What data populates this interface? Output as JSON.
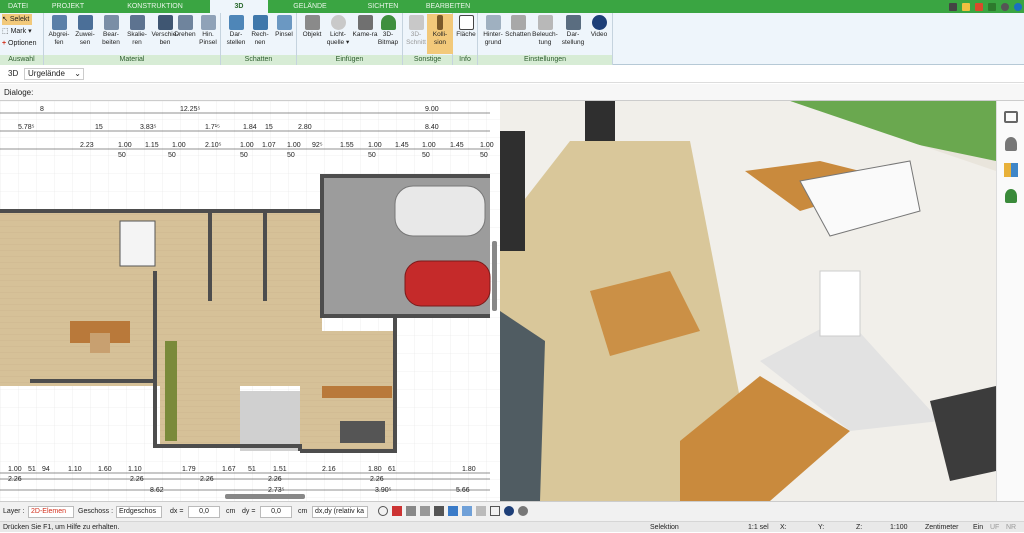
{
  "tabs": [
    "DATEI",
    "PROJEKT",
    "KONSTRUKTION",
    "3D",
    "GELÄNDE",
    "SICHTEN",
    "BEARBEITEN"
  ],
  "ribbon": {
    "select": {
      "selekt": "Selekt",
      "mark": "Mark",
      "optionen": "Optionen",
      "group": "Auswahl"
    },
    "material": {
      "group": "Material",
      "buttons": [
        "Abgrei-fen",
        "Zuwei-sen",
        "Bear-beiten",
        "Skalie-ren",
        "Verschie-ben",
        "Drehen",
        "Hin. Pinsel"
      ]
    },
    "schatten": {
      "group": "Schatten",
      "buttons": [
        "Dar-stellen",
        "Rech-nen",
        "Pinsel"
      ]
    },
    "einfuegen": {
      "group": "Einfügen",
      "buttons": [
        "Objekt",
        "Licht-quelle",
        "Kame-ra",
        "3D-Bitmap"
      ]
    },
    "sonstige": {
      "group": "Sonstige",
      "buttons": [
        "3D-Schnitt",
        "Kolli-sion"
      ]
    },
    "info": {
      "group": "Info",
      "buttons": [
        "Fläche"
      ]
    },
    "einstellungen": {
      "group": "Einstellungen",
      "buttons": [
        "Hinter-grund",
        "Schatten",
        "Beleuch-tung",
        "Dar-stellung",
        "Video"
      ]
    }
  },
  "optbar": {
    "mode": "3D",
    "terrain": "Urgelände"
  },
  "dialog": {
    "label": "Dialoge:"
  },
  "dims": {
    "top1": [
      "8",
      "12.25⁵",
      "9.00"
    ],
    "top2": [
      "5.78⁵",
      "15",
      "3.83⁵",
      "1.7¹⁵",
      "1.84",
      "15",
      "2.80",
      "8.40"
    ],
    "top3": [
      "2.23",
      "1.00",
      "1.15",
      "1.00",
      "2.10⁵",
      "1.00",
      "1.07",
      "1.00",
      "92⁵",
      "1.55",
      "1.00",
      "1.45",
      "1.00",
      "1.45",
      "1.00"
    ],
    "top3b": [
      "50",
      "50",
      "50",
      "50",
      "50",
      "50",
      "50"
    ],
    "bot1": [
      "1.00",
      "51",
      "94",
      "1.10",
      "1.60",
      "1.10",
      "1.79",
      "1.67",
      "51",
      "1.51",
      "2.16",
      "1.80",
      "61",
      "1.80"
    ],
    "bot2": [
      "2.26",
      "2.26",
      "2.26",
      "2.26",
      "2.26"
    ],
    "bot3": [
      "8.62",
      "2.73⁵",
      "3.90⁵",
      "5.66"
    ]
  },
  "status": {
    "layer_label": "Layer :",
    "layer": "2D-Elemen",
    "geschoss_label": "Geschoss :",
    "geschoss": "Erdgeschos",
    "dx": "dx =",
    "dx_val": "0,0",
    "dy": "dy =",
    "dy_val": "0,0",
    "cm": "cm",
    "mode": "dx,dy (relativ ka"
  },
  "hint": {
    "text": "Drücken Sie F1, um Hilfe zu erhalten.",
    "selektion": "Selektion",
    "sel": "1:1 sel",
    "x": "X:",
    "y": "Y:",
    "z": "Z:",
    "scale": "1:100",
    "unit": "Zentimeter",
    "ein": "Ein",
    "uf": "UF",
    "nr": "NR"
  },
  "colors": {
    "green": "#3aa542",
    "ribbon": "#eef5fb",
    "floor": "#d9c79a",
    "wood": "#c98a3d",
    "grass": "#6aa84f"
  }
}
